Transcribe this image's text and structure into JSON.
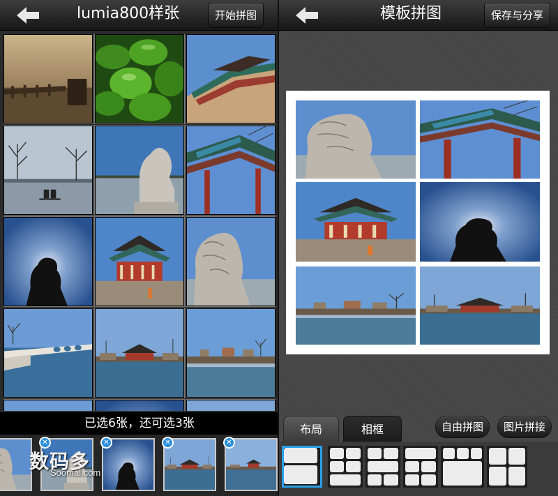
{
  "left_panel": {
    "title": "lumia800样张",
    "start_button": "开始拼图",
    "status": "已选6张，还可选3张"
  },
  "right_panel": {
    "title": "模板拼图",
    "save_share_button": "保存与分享",
    "tabs": [
      {
        "label": "布局",
        "active": true
      },
      {
        "label": "相框",
        "active": false
      }
    ],
    "free_collage_button": "自由拼图",
    "photo_stitch_button": "图片拼接"
  },
  "watermark": {
    "cn": "数码多",
    "en": "Soomal.com"
  },
  "photos": [
    "sepia-bridge",
    "green-peppers",
    "pavilion-roof",
    "lake-trees-couple",
    "stone-lion",
    "archway-gate",
    "lion-silhouette",
    "pavilion-red",
    "stone-lion-closeup",
    "arch-bridge-lake",
    "lake-buildings",
    "lakeshore-town"
  ],
  "tray": [
    "stone-lion-closeup",
    "stone-lion",
    "lion-silhouette",
    "lake-buildings",
    "lake-buildings-2"
  ],
  "collage_slots": [
    "stone-lion-closeup",
    "archway-gate",
    "pavilion-red",
    "lion-silhouette",
    "lakeshore-town",
    "lake-buildings"
  ],
  "layout_options": 6,
  "selected_layout": 0,
  "colors": {
    "accent": "#2aa0e8",
    "badge": "#2a8fdc"
  }
}
